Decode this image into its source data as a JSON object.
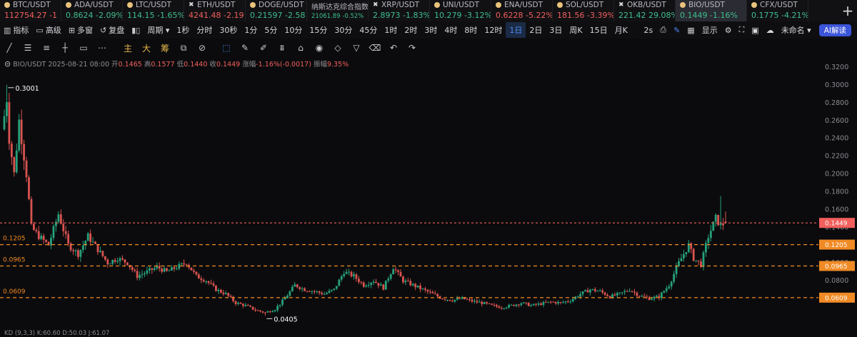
{
  "tickers": [
    {
      "name": "BTC/USDT",
      "price": "112754.27",
      "change": "-1",
      "dir": "dn",
      "icon": "dot"
    },
    {
      "name": "ADA/USDT",
      "price": "0.8624",
      "change": "-2.09%",
      "dir": "up",
      "icon": "dot"
    },
    {
      "name": "LTC/USDT",
      "price": "114.15",
      "change": "-1.65%",
      "dir": "up",
      "icon": "dot"
    },
    {
      "name": "ETH/USDT",
      "price": "4241.48",
      "change": "-2.19",
      "dir": "dn",
      "icon": "cross"
    },
    {
      "name": "DOGE/USDT",
      "price": "0.21597",
      "change": "-2.58",
      "dir": "up",
      "icon": "dot"
    },
    {
      "name": "纳斯达克综合指数",
      "price": "21061.89",
      "change": "-0.52%",
      "dir": "up",
      "icon": "none",
      "small": true
    },
    {
      "name": "XRP/USDT",
      "price": "2.8973",
      "change": "-1.83%",
      "dir": "up",
      "icon": "cross"
    },
    {
      "name": "UNI/USDT",
      "price": "10.279",
      "change": "-3.12%",
      "dir": "up",
      "icon": "dot"
    },
    {
      "name": "ENA/USDT",
      "price": "0.6228",
      "change": "-5.22%",
      "dir": "dn",
      "icon": "dot"
    },
    {
      "name": "SOL/USDT",
      "price": "181.56",
      "change": "-3.39%",
      "dir": "dn",
      "icon": "dot"
    },
    {
      "name": "OKB/USDT",
      "price": "221.42",
      "change": "29.08%",
      "dir": "up",
      "icon": "cross"
    },
    {
      "name": "BIO/USDT",
      "price": "0.1449",
      "change": "-1.16%",
      "dir": "up",
      "icon": "dot",
      "active": true
    },
    {
      "name": "CFX/USDT",
      "price": "0.1775",
      "change": "-4.21%",
      "dir": "up",
      "icon": "dot"
    }
  ],
  "toolbar1": {
    "left": [
      {
        "icon": "indicator-icon",
        "glyph": "▥",
        "label": "指标"
      },
      {
        "icon": "calendar-icon",
        "glyph": "▭",
        "label": "高级"
      },
      {
        "icon": "grid-icon",
        "glyph": "⊞",
        "label": "多窗"
      },
      {
        "icon": "replay-icon",
        "glyph": "↺",
        "label": "复盘"
      },
      {
        "icon": "candles-icon",
        "glyph": "▮▯",
        "label": ""
      },
      {
        "icon": "",
        "glyph": "",
        "label": "周期 ▾"
      }
    ],
    "periods": [
      "1秒",
      "分时",
      "30秒",
      "1分",
      "5分",
      "10分",
      "15分",
      "30分",
      "45分",
      "1时",
      "2时",
      "3时",
      "4时",
      "8时",
      "12时",
      "1日",
      "2日",
      "3日",
      "周K",
      "15日",
      "月K"
    ],
    "selected_period": "1日",
    "right": [
      "2s",
      "显示",
      "未命名 ▾"
    ],
    "ai_label": "AI解读"
  },
  "toolbar2": {
    "tools": [
      {
        "name": "trend-line-icon",
        "glyph": "╱"
      },
      {
        "name": "h-lines-icon",
        "glyph": "☰"
      },
      {
        "name": "parallel-lines-icon",
        "glyph": "≡"
      },
      {
        "name": "horizontal-ray-icon",
        "glyph": "┼"
      },
      {
        "name": "rectangle-icon",
        "glyph": "▭"
      },
      {
        "name": "more-icon",
        "glyph": "⋯"
      },
      {
        "name": "main-label",
        "glyph": "主",
        "yellow": true
      },
      {
        "name": "big-label",
        "glyph": "大",
        "yellow": true
      },
      {
        "name": "chip-label",
        "glyph": "筹",
        "yellow": true
      },
      {
        "name": "snapshot-icon",
        "glyph": "⧉"
      },
      {
        "name": "measure-icon",
        "glyph": "⊘"
      },
      {
        "name": "select-icon",
        "glyph": "⬚",
        "blue": true
      },
      {
        "name": "ruler-icon",
        "glyph": "✎"
      },
      {
        "name": "brush-icon",
        "glyph": "✐"
      },
      {
        "name": "pattern-icon",
        "glyph": "⩩"
      },
      {
        "name": "lock-icon",
        "glyph": "⌂"
      },
      {
        "name": "eye-icon",
        "glyph": "◉"
      },
      {
        "name": "magnet-icon",
        "glyph": "◇"
      },
      {
        "name": "filter-icon",
        "glyph": "▽"
      },
      {
        "name": "trash-icon",
        "glyph": "⌫"
      },
      {
        "name": "undo-icon",
        "glyph": "↶"
      },
      {
        "name": "redo-icon",
        "glyph": "↷"
      }
    ]
  },
  "info": {
    "symbol": "BIO/USDT",
    "date": "2025-08-21 08:00",
    "open_label": "开",
    "open": "0.1465",
    "high_label": "高",
    "high": "0.1577",
    "low_label": "低",
    "low": "0.1440",
    "close_label": "收",
    "close": "0.1449",
    "chg_label": "涨幅",
    "chg": "-1.16%(-0.0017)",
    "amp_label": "振幅",
    "amp": "9.35%"
  },
  "kd_line": "KD (9,3,3)  K:60.60  D:50.03  J:61.07",
  "chart_data": {
    "type": "candlestick",
    "symbol": "BIO/USDT",
    "interval": "1日",
    "ylim": [
      0.04,
      0.32
    ],
    "y_ticks": [
      "0.3200",
      "0.3000",
      "0.2800",
      "0.2600",
      "0.2400",
      "0.2200",
      "0.2000",
      "0.1800",
      "0.1600",
      "0.1400",
      "0.1200",
      "0.1000",
      "0.0800",
      "0.0600"
    ],
    "annotations": [
      {
        "text": "0.3001",
        "value": 0.3001,
        "kind": "high"
      },
      {
        "text": "0.0405",
        "value": 0.0405,
        "kind": "low"
      }
    ],
    "levels": [
      {
        "value": 0.1449,
        "label": "0.1449",
        "color": "#f25f5c",
        "style": "dashed",
        "left_label": ""
      },
      {
        "value": 0.1205,
        "label": "0.1205",
        "color": "#f08a24",
        "style": "dashed",
        "left_label": "0.1205"
      },
      {
        "value": 0.0965,
        "label": "0.0965",
        "color": "#f08a24",
        "style": "dashed",
        "left_label": "0.0965"
      },
      {
        "value": 0.0609,
        "label": "0.0609",
        "color": "#f08a24",
        "style": "dashed",
        "left_label": "0.0609"
      }
    ],
    "anchors": [
      [
        0,
        0.265
      ],
      [
        1,
        0.285
      ],
      [
        2,
        0.24
      ],
      [
        4,
        0.2
      ],
      [
        6,
        0.26
      ],
      [
        9,
        0.2
      ],
      [
        11,
        0.14
      ],
      [
        14,
        0.13
      ],
      [
        18,
        0.12
      ],
      [
        22,
        0.155
      ],
      [
        26,
        0.12
      ],
      [
        30,
        0.11
      ],
      [
        34,
        0.13
      ],
      [
        38,
        0.115
      ],
      [
        42,
        0.1
      ],
      [
        46,
        0.105
      ],
      [
        50,
        0.1
      ],
      [
        54,
        0.085
      ],
      [
        58,
        0.09
      ],
      [
        62,
        0.095
      ],
      [
        66,
        0.09
      ],
      [
        70,
        0.095
      ],
      [
        74,
        0.1
      ],
      [
        78,
        0.085
      ],
      [
        82,
        0.08
      ],
      [
        86,
        0.07
      ],
      [
        90,
        0.065
      ],
      [
        94,
        0.055
      ],
      [
        98,
        0.052
      ],
      [
        102,
        0.047
      ],
      [
        106,
        0.044
      ],
      [
        110,
        0.048
      ],
      [
        114,
        0.06
      ],
      [
        118,
        0.075
      ],
      [
        122,
        0.07
      ],
      [
        126,
        0.068
      ],
      [
        130,
        0.065
      ],
      [
        134,
        0.07
      ],
      [
        138,
        0.09
      ],
      [
        142,
        0.085
      ],
      [
        146,
        0.075
      ],
      [
        150,
        0.08
      ],
      [
        154,
        0.072
      ],
      [
        158,
        0.095
      ],
      [
        162,
        0.08
      ],
      [
        166,
        0.075
      ],
      [
        170,
        0.07
      ],
      [
        174,
        0.065
      ],
      [
        178,
        0.06
      ],
      [
        182,
        0.058
      ],
      [
        186,
        0.06
      ],
      [
        190,
        0.057
      ],
      [
        194,
        0.055
      ],
      [
        198,
        0.052
      ],
      [
        202,
        0.05
      ],
      [
        206,
        0.052
      ],
      [
        210,
        0.055
      ],
      [
        214,
        0.052
      ],
      [
        218,
        0.054
      ],
      [
        222,
        0.056
      ],
      [
        226,
        0.055
      ],
      [
        230,
        0.058
      ],
      [
        234,
        0.065
      ],
      [
        238,
        0.07
      ],
      [
        242,
        0.068
      ],
      [
        246,
        0.062
      ],
      [
        250,
        0.065
      ],
      [
        254,
        0.07
      ],
      [
        258,
        0.063
      ],
      [
        262,
        0.06
      ],
      [
        266,
        0.062
      ],
      [
        270,
        0.075
      ],
      [
        274,
        0.1
      ],
      [
        278,
        0.12
      ],
      [
        280,
        0.105
      ],
      [
        283,
        0.098
      ],
      [
        286,
        0.13
      ],
      [
        289,
        0.15
      ],
      [
        291,
        0.142
      ],
      [
        293,
        0.1449
      ]
    ],
    "bars": 294,
    "candle_up_color": "#26a17b",
    "candle_down_color": "#d9534f"
  }
}
